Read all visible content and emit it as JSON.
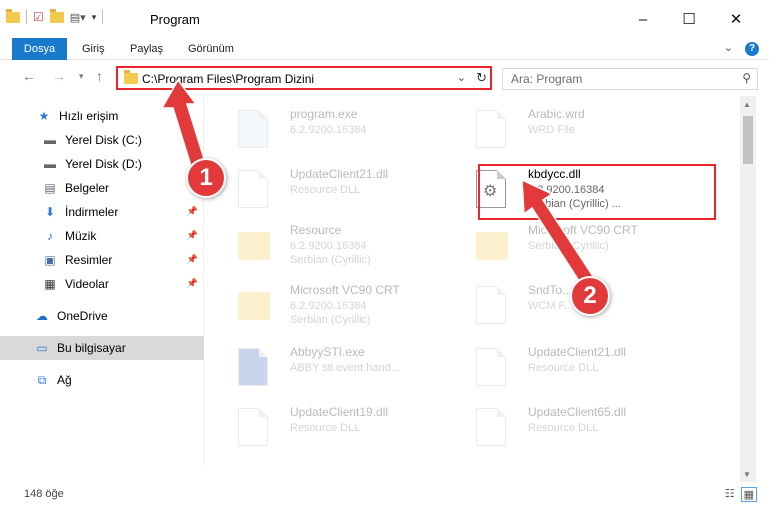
{
  "window": {
    "title": "Program",
    "controls": {
      "minimize": "–",
      "maximize": "☐",
      "close": "✕"
    }
  },
  "ribbon": {
    "tabs": [
      "Dosya",
      "Giriş",
      "Paylaş",
      "Görünüm"
    ]
  },
  "address": {
    "path": "C:\\Program Files\\Program Dizini"
  },
  "search": {
    "placeholder": "Ara: Program"
  },
  "sidebar": {
    "items": [
      {
        "label": "Hızlı erişim",
        "icon": "star-icon"
      },
      {
        "label": "Yerel Disk (C:)",
        "icon": "drive-icon"
      },
      {
        "label": "Yerel Disk (D:)",
        "icon": "drive-icon"
      },
      {
        "label": "Belgeler",
        "icon": "documents-icon"
      },
      {
        "label": "İndirmeler",
        "icon": "download-icon"
      },
      {
        "label": "Müzik",
        "icon": "music-icon"
      },
      {
        "label": "Resimler",
        "icon": "pictures-icon"
      },
      {
        "label": "Videolar",
        "icon": "videos-icon"
      },
      {
        "label": "OneDrive",
        "icon": "cloud-icon"
      },
      {
        "label": "Bu bilgisayar",
        "icon": "computer-icon"
      },
      {
        "label": "Ağ",
        "icon": "network-icon"
      }
    ]
  },
  "files": [
    {
      "name": "program.exe",
      "line2": "6.2.9200.16384",
      "line3": "",
      "icon": "exe"
    },
    {
      "name": "Arabic.wrd",
      "line2": "WRD File",
      "line3": "",
      "icon": "doc"
    },
    {
      "name": "UpdateClient21.dll",
      "line2": "Resource DLL",
      "line3": "",
      "icon": "doc"
    },
    {
      "name": "kbdycc.dll",
      "line2": "6.2.9200.16384",
      "line3": "Serbian (Cyrillic) ...",
      "icon": "dll"
    },
    {
      "name": "Resource",
      "line2": "6.2.9200.16384",
      "line3": "Serbian (Cyrillic)",
      "icon": "folder"
    },
    {
      "name": "Microsoft VC90 CRT",
      "line2": "Serbian (Cyrillic)",
      "line3": "",
      "icon": "folder"
    },
    {
      "name": "Microsoft VC90 CRT",
      "line2": "6.2.9200.16384",
      "line3": "Serbian (Cyrillic)",
      "icon": "folder"
    },
    {
      "name": "SndTo...",
      "line2": "WCM F...",
      "line3": "",
      "icon": "doc"
    },
    {
      "name": "AbbyySTI.exe",
      "line2": "ABBY sti event hand...",
      "line3": "",
      "icon": "exe"
    },
    {
      "name": "UpdateClient21.dll",
      "line2": "Resource DLL",
      "line3": "",
      "icon": "doc"
    },
    {
      "name": "UpdateClient19.dll",
      "line2": "Resource DLL",
      "line3": "",
      "icon": "doc"
    },
    {
      "name": "UpdateClient65.dll",
      "line2": "Resource DLL",
      "line3": "",
      "icon": "doc"
    }
  ],
  "badges": {
    "one": "1",
    "two": "2"
  },
  "status": {
    "count": "148 öğe"
  },
  "colors": {
    "accent": "#1979ca",
    "highlight": "#e8262c",
    "badge": "#e23a3a"
  }
}
